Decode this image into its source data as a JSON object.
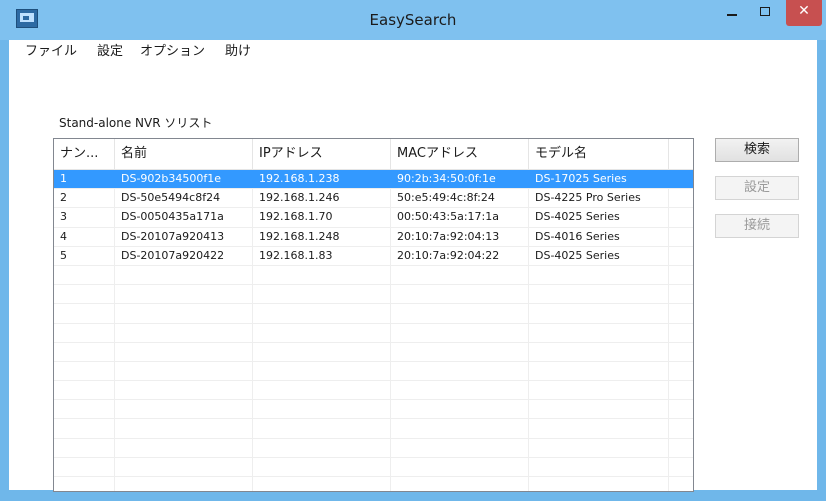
{
  "window": {
    "title": "EasySearch"
  },
  "menu": [
    "ファイル",
    "設定",
    "オプション",
    "助け"
  ],
  "group_label": "Stand-alone NVR ソリスト",
  "table": {
    "columns": [
      "ナン...",
      "名前",
      "IPアドレス",
      "MACアドレス",
      "モデル名"
    ],
    "rows": [
      [
        "1",
        "DS-902b34500f1e",
        "192.168.1.238",
        "90:2b:34:50:0f:1e",
        "DS-17025 Series"
      ],
      [
        "2",
        "DS-50e5494c8f24",
        "192.168.1.246",
        "50:e5:49:4c:8f:24",
        "DS-4225 Pro Series"
      ],
      [
        "3",
        "DS-0050435a171a",
        "192.168.1.70",
        "00:50:43:5a:17:1a",
        "DS-4025 Series"
      ],
      [
        "4",
        "DS-20107a920413",
        "192.168.1.248",
        "20:10:7a:92:04:13",
        "DS-4016 Series"
      ],
      [
        "5",
        "DS-20107a920422",
        "192.168.1.83",
        "20:10:7a:92:04:22",
        "DS-4025 Series"
      ]
    ],
    "selected_row": 1
  },
  "buttons": {
    "search": "検索",
    "settings": "設定",
    "connect": "接続"
  },
  "colors": {
    "selection": "#3399ff",
    "titlebar": "#7fc1ef",
    "close": "#c75050"
  }
}
